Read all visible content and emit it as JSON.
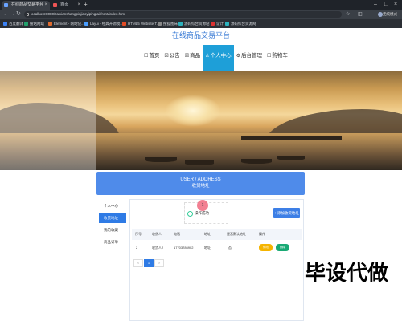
{
  "browser": {
    "tabs": [
      {
        "label": "在线商品交易平台",
        "active": true
      },
      {
        "label": "首页",
        "active": false
      }
    ],
    "url": "localhost:8080/zaixianshangpinjiaoyipingtai/front/index.html",
    "user_name": "无痕模式",
    "bookmarks": [
      "百度翻译",
      "搜站网站",
      "Element - 网站快...",
      "Layui - 经典开源模...",
      "HTML5 Website T...",
      "搜狐图床",
      "源码综合资源站",
      "设计",
      "源码综合资源网"
    ]
  },
  "site": {
    "title": "在线商品交易平台",
    "nav": [
      {
        "icon": "☐",
        "label": "首页",
        "active": false
      },
      {
        "icon": "☒",
        "label": "公告",
        "active": false
      },
      {
        "icon": "☒",
        "label": "商品",
        "active": false
      },
      {
        "icon": "♙",
        "label": "个人中心",
        "active": true
      },
      {
        "icon": "⚙",
        "label": "后台管理",
        "active": false
      },
      {
        "icon": "☐",
        "label": "购物车",
        "active": false
      }
    ]
  },
  "panel": {
    "heading_en": "USER / ADDRESS",
    "heading_cn": "收货地址",
    "sidebar": [
      {
        "label": "个人中心",
        "active": false
      },
      {
        "label": "收货地址",
        "active": true
      },
      {
        "label": "我的收藏",
        "active": false
      },
      {
        "label": "商品订单",
        "active": false
      }
    ],
    "operation_label": "操作成功",
    "marker": "1",
    "add_button": "添加收货地址",
    "table": {
      "headers": [
        "序号",
        "收货人",
        "电话",
        "地址",
        "是否默认地址",
        "操作"
      ],
      "rows": [
        {
          "index": "2",
          "receiver": "收货人2",
          "phone": "17703786902",
          "address": "地址",
          "default": "否"
        }
      ],
      "edit_label": "修改",
      "delete_label": "删除"
    },
    "pager": [
      "<",
      "1",
      ">"
    ]
  },
  "watermark": "毕设代做",
  "colors": {
    "primary": "#4f8bea",
    "nav_active": "#1e9fd8",
    "edit": "#f5b400",
    "delete": "#19a974"
  }
}
